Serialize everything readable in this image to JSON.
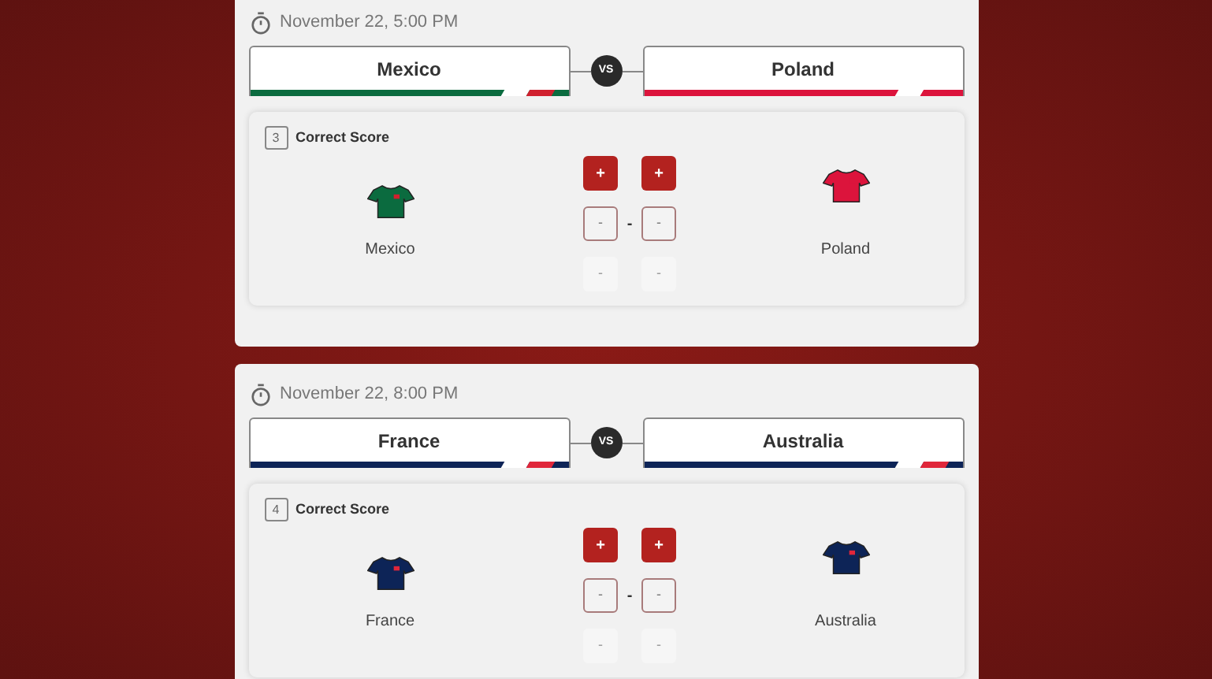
{
  "matches": [
    {
      "time": "November 22, 5:00 PM",
      "vs": "VS",
      "home": {
        "name": "Mexico",
        "color": "#0b6b3f",
        "bands": [
          {
            "color": "#ffffff"
          },
          {
            "color": "#d0202e"
          }
        ]
      },
      "away": {
        "name": "Poland",
        "color": "#dc143c",
        "bands": [
          {
            "color": "#ffffff"
          },
          {
            "color": "#dc143c"
          }
        ]
      },
      "market": {
        "number": "3",
        "label": "Correct Score"
      },
      "separator": "-",
      "home_label": "Mexico",
      "away_label": "Poland",
      "home_score": {
        "plus": "+",
        "value": "-",
        "minus": "-"
      },
      "away_score": {
        "plus": "+",
        "value": "-",
        "minus": "-"
      }
    },
    {
      "time": "November 22, 8:00 PM",
      "vs": "VS",
      "home": {
        "name": "France",
        "color": "#0d2457",
        "bands": [
          {
            "color": "#ffffff"
          },
          {
            "color": "#e0263a"
          }
        ]
      },
      "away": {
        "name": "Australia",
        "color": "#0d2457",
        "bands": [
          {
            "color": "#ffffff"
          },
          {
            "color": "#e0263a"
          }
        ]
      },
      "market": {
        "number": "4",
        "label": "Correct Score"
      },
      "separator": "-",
      "home_label": "France",
      "away_label": "Australia",
      "home_score": {
        "plus": "+",
        "value": "-",
        "minus": "-"
      },
      "away_score": {
        "plus": "+",
        "value": "-",
        "minus": "-"
      }
    }
  ]
}
